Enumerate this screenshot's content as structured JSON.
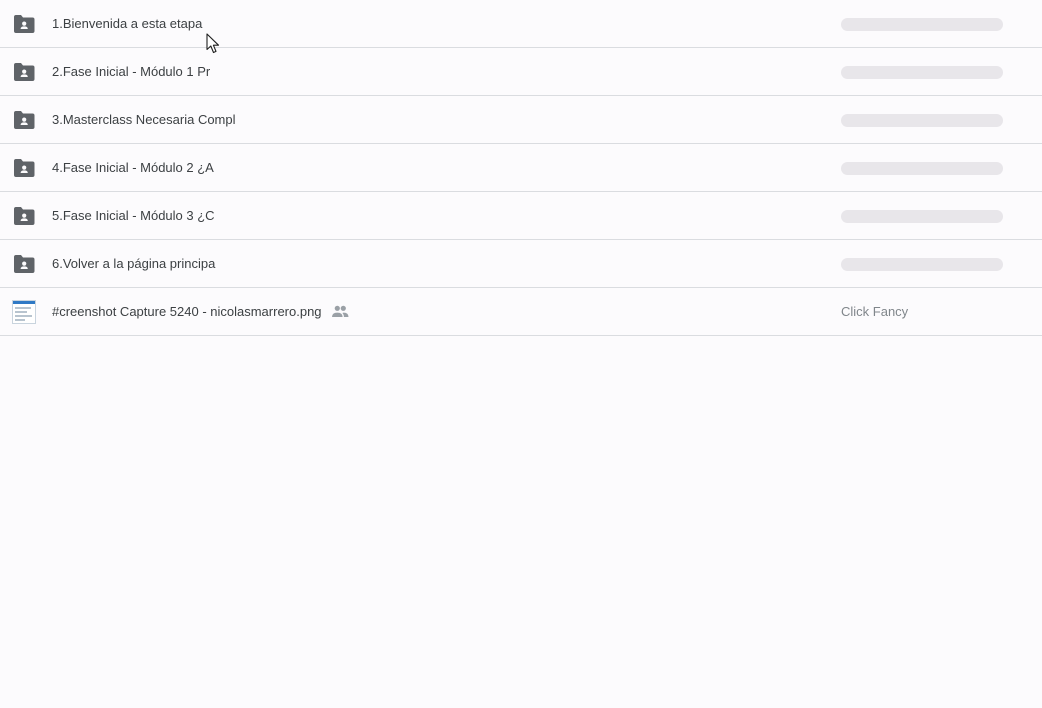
{
  "file_list": {
    "rows": [
      {
        "type": "folder",
        "icon": "shared-folder-icon",
        "name": "1.Bienvenida a esta etapa"
      },
      {
        "type": "folder",
        "icon": "shared-folder-icon",
        "name": "2.Fase Inicial - Módulo 1  Pr"
      },
      {
        "type": "folder",
        "icon": "shared-folder-icon",
        "name": "3.Masterclass Necesaria Compl"
      },
      {
        "type": "folder",
        "icon": "shared-folder-icon",
        "name": "4.Fase Inicial - Módulo 2  ¿A"
      },
      {
        "type": "folder",
        "icon": "shared-folder-icon",
        "name": "5.Fase Inicial - Módulo 3  ¿C"
      },
      {
        "type": "folder",
        "icon": "shared-folder-icon",
        "name": "6.Volver a la página principa"
      },
      {
        "type": "image",
        "icon": "image-thumbnail-icon",
        "name": "#creenshot Capture 5240 - nicolasmarrero.png",
        "shared_icon": "shared-people-icon",
        "owner": "Click Fancy"
      }
    ]
  },
  "colors": {
    "background": "#fcfbfd",
    "folder_icon": "#5f6368",
    "divider": "#dadce0",
    "placeholder": "#e8e6ea",
    "text": "#3c4043",
    "secondary_text": "#80868b"
  }
}
